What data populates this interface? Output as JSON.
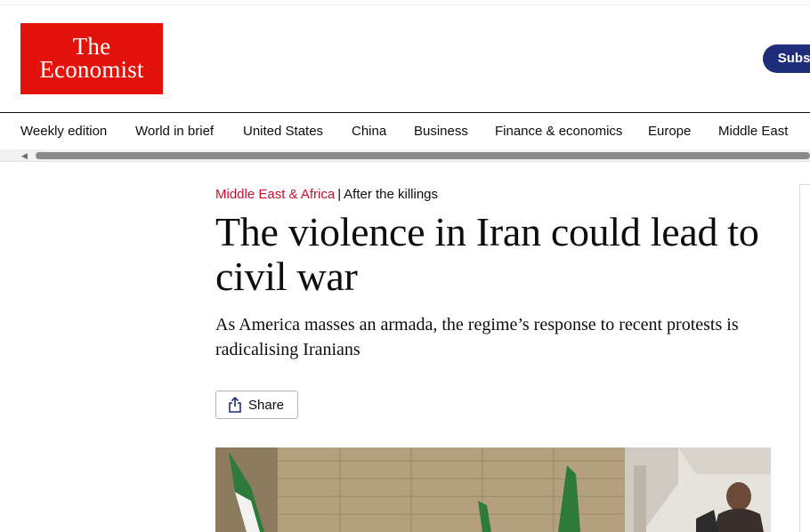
{
  "header": {
    "logo_line1": "The",
    "logo_line2": "Economist",
    "subscribe_label": "Subscribe",
    "brand_color": "#e3120b",
    "subscribe_color": "#1f2e7a"
  },
  "nav": {
    "items": [
      {
        "label": "Weekly edition"
      },
      {
        "label": "World in brief"
      },
      {
        "label": "United States"
      },
      {
        "label": "China"
      },
      {
        "label": "Business"
      },
      {
        "label": "Finance & economics"
      },
      {
        "label": "Europe"
      },
      {
        "label": "Middle East"
      }
    ]
  },
  "article": {
    "section": "Middle East & Africa",
    "separator": "|",
    "flytitle": "After the killings",
    "headline": "The violence in Iran could lead to civil war",
    "subheadline": "As America masses an armada, the regime’s response to recent protests is radicalising Iranians",
    "share_label": "Share",
    "share_icon": "share-icon",
    "section_color": "#c8102e"
  }
}
